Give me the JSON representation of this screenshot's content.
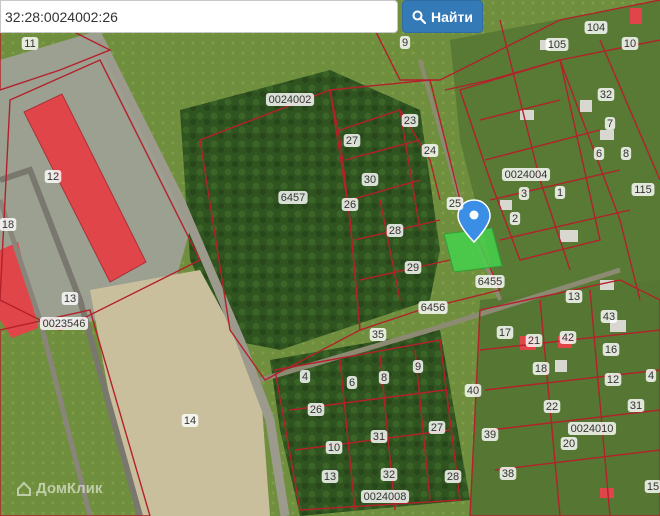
{
  "search": {
    "value": "32:28:0024002:26",
    "button_label": "Найти"
  },
  "watermark": {
    "text": "ДомКлик"
  },
  "quarters": [
    "0024002",
    "0024004",
    "0023546",
    "0024010",
    "0024008"
  ],
  "parcels": [
    "11",
    "12",
    "13",
    "14",
    "18",
    "9",
    "105",
    "104",
    "10",
    "32",
    "7",
    "6",
    "8",
    "3",
    "1",
    "115",
    "2",
    "23",
    "24",
    "27",
    "30",
    "25",
    "26",
    "28",
    "29",
    "6457",
    "6455",
    "6456",
    "35",
    "4",
    "6",
    "8",
    "9",
    "26",
    "40",
    "39",
    "27",
    "31",
    "10",
    "32",
    "13",
    "28",
    "38",
    "17",
    "21",
    "42",
    "18",
    "22",
    "31",
    "20",
    "13",
    "43",
    "16",
    "4",
    "12",
    "15"
  ],
  "colors": {
    "boundary": "#b3212a",
    "selected": "#45d14c",
    "marker": "#3a8ee6",
    "roof": "#e0454a"
  }
}
